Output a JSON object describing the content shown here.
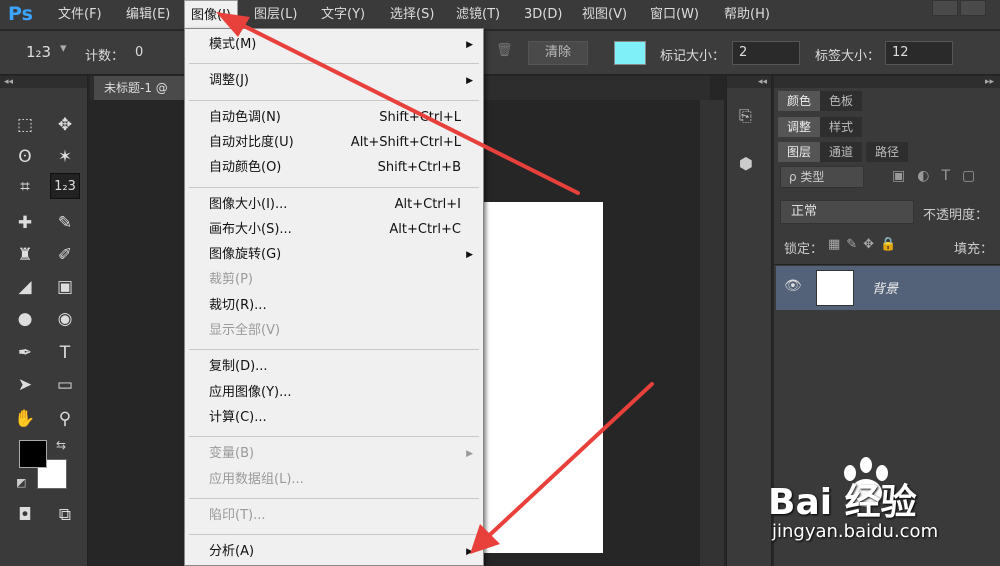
{
  "app": {
    "logo": "Ps"
  },
  "menubar": [
    {
      "label": "文件(F)",
      "active": false
    },
    {
      "label": "编辑(E)",
      "active": false
    },
    {
      "label": "图像(I)",
      "active": true
    },
    {
      "label": "图层(L)",
      "active": false
    },
    {
      "label": "文字(Y)",
      "active": false
    },
    {
      "label": "选择(S)",
      "active": false
    },
    {
      "label": "滤镜(T)",
      "active": false
    },
    {
      "label": "3D(D)",
      "active": false
    },
    {
      "label": "视图(V)",
      "active": false
    },
    {
      "label": "窗口(W)",
      "active": false
    },
    {
      "label": "帮助(H)",
      "active": false
    }
  ],
  "options": {
    "tool_glyph": "1₂3",
    "count_label": "计数：",
    "count_value": "0",
    "clear_label": "清除",
    "marker_size_label": "标记大小：",
    "marker_size_value": "2",
    "label_size_label": "标签大小：",
    "label_size_value": "12",
    "marker_color": "#80f0f8"
  },
  "document": {
    "tab_title": "未标题-1 @"
  },
  "image_menu": {
    "items": [
      {
        "label": "模式(M)",
        "shortcut": "",
        "submenu": true,
        "disabled": false
      },
      {
        "sep": true
      },
      {
        "label": "调整(J)",
        "shortcut": "",
        "submenu": true,
        "disabled": false
      },
      {
        "sep": true
      },
      {
        "label": "自动色调(N)",
        "shortcut": "Shift+Ctrl+L",
        "submenu": false,
        "disabled": false
      },
      {
        "label": "自动对比度(U)",
        "shortcut": "Alt+Shift+Ctrl+L",
        "submenu": false,
        "disabled": false
      },
      {
        "label": "自动颜色(O)",
        "shortcut": "Shift+Ctrl+B",
        "submenu": false,
        "disabled": false
      },
      {
        "sep": true
      },
      {
        "label": "图像大小(I)...",
        "shortcut": "Alt+Ctrl+I",
        "submenu": false,
        "disabled": false
      },
      {
        "label": "画布大小(S)...",
        "shortcut": "Alt+Ctrl+C",
        "submenu": false,
        "disabled": false
      },
      {
        "label": "图像旋转(G)",
        "shortcut": "",
        "submenu": true,
        "disabled": false
      },
      {
        "label": "裁剪(P)",
        "shortcut": "",
        "submenu": false,
        "disabled": true
      },
      {
        "label": "裁切(R)...",
        "shortcut": "",
        "submenu": false,
        "disabled": false
      },
      {
        "label": "显示全部(V)",
        "shortcut": "",
        "submenu": false,
        "disabled": true
      },
      {
        "sep": true
      },
      {
        "label": "复制(D)...",
        "shortcut": "",
        "submenu": false,
        "disabled": false
      },
      {
        "label": "应用图像(Y)...",
        "shortcut": "",
        "submenu": false,
        "disabled": false
      },
      {
        "label": "计算(C)...",
        "shortcut": "",
        "submenu": false,
        "disabled": false
      },
      {
        "sep": true
      },
      {
        "label": "变量(B)",
        "shortcut": "",
        "submenu": true,
        "disabled": true
      },
      {
        "label": "应用数据组(L)...",
        "shortcut": "",
        "submenu": false,
        "disabled": true
      },
      {
        "sep": true
      },
      {
        "label": "陷印(T)...",
        "shortcut": "",
        "submenu": false,
        "disabled": true
      },
      {
        "sep": true
      },
      {
        "label": "分析(A)",
        "shortcut": "",
        "submenu": true,
        "disabled": false
      }
    ]
  },
  "right_panel": {
    "tabs_row1": [
      "颜色",
      "色板"
    ],
    "tabs_row2": [
      "调整",
      "样式"
    ],
    "tabs_row3": [
      "图层",
      "通道",
      "路径"
    ],
    "kind_filter": "ρ 类型",
    "blend_mode": "正常",
    "opacity_label": "不透明度：",
    "lock_label": "锁定：",
    "fill_label": "填充：",
    "layer_name": "背景"
  },
  "watermark": {
    "brand": "Bai 经验",
    "url": "jingyan.baidu.com"
  },
  "annotation_color": "#e8403a"
}
